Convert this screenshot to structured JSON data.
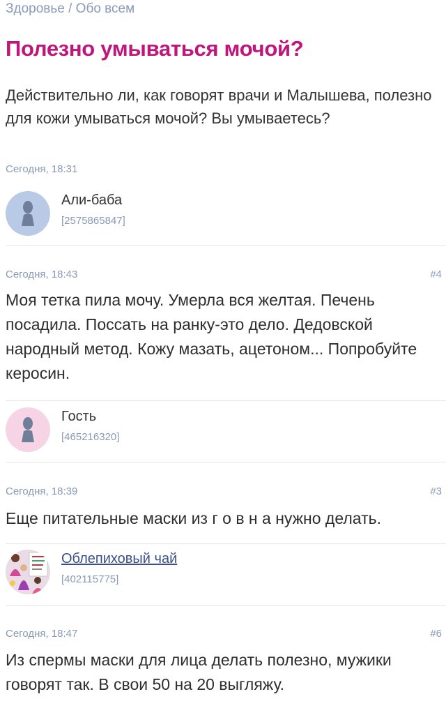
{
  "breadcrumb": {
    "section": "Здоровье",
    "separator": "/",
    "category": "Обо всем"
  },
  "question": {
    "title": "Полезно умываться мочой?",
    "body": "Действительно ли, как говорят врачи и Малышева, полезно для кожи умываться мочой? Вы умываетесь?",
    "timestamp": "Сегодня, 18:31",
    "author": {
      "name": "Али-баба",
      "id": "[2575865847]",
      "avatar": "person-silhouette-icon"
    }
  },
  "answers": [
    {
      "timestamp": "Сегодня, 18:43",
      "number": "#4",
      "text": "Моя тетка пила мочу. Умерла вся желтая. Печень посадила. Поссать на ранку-это дело. Дедовской народный метод. Кожу мазать, ацетоном... Попробуйте керосин.",
      "author": {
        "name": "Гость",
        "id": "[465216320]",
        "avatar": "person-silhouette-icon"
      }
    },
    {
      "timestamp": "Сегодня, 18:39",
      "number": "#3",
      "text": "Еще питательные маски из г о в н а нужно делать.",
      "author": {
        "name": "Облепиховый чай",
        "id": "[402115775]",
        "avatar": "photo-collage-avatar"
      }
    },
    {
      "timestamp": "Сегодня, 18:47",
      "number": "#6",
      "text": "Из спермы маски для лица делать полезно, мужики говорят так. В свои 50 на 20 выгляжу."
    }
  ],
  "colors": {
    "title": "#c0157a",
    "meta": "#8a9ab8",
    "avatar_blue": "#b9cae6",
    "avatar_pink": "#f6d4e6"
  }
}
